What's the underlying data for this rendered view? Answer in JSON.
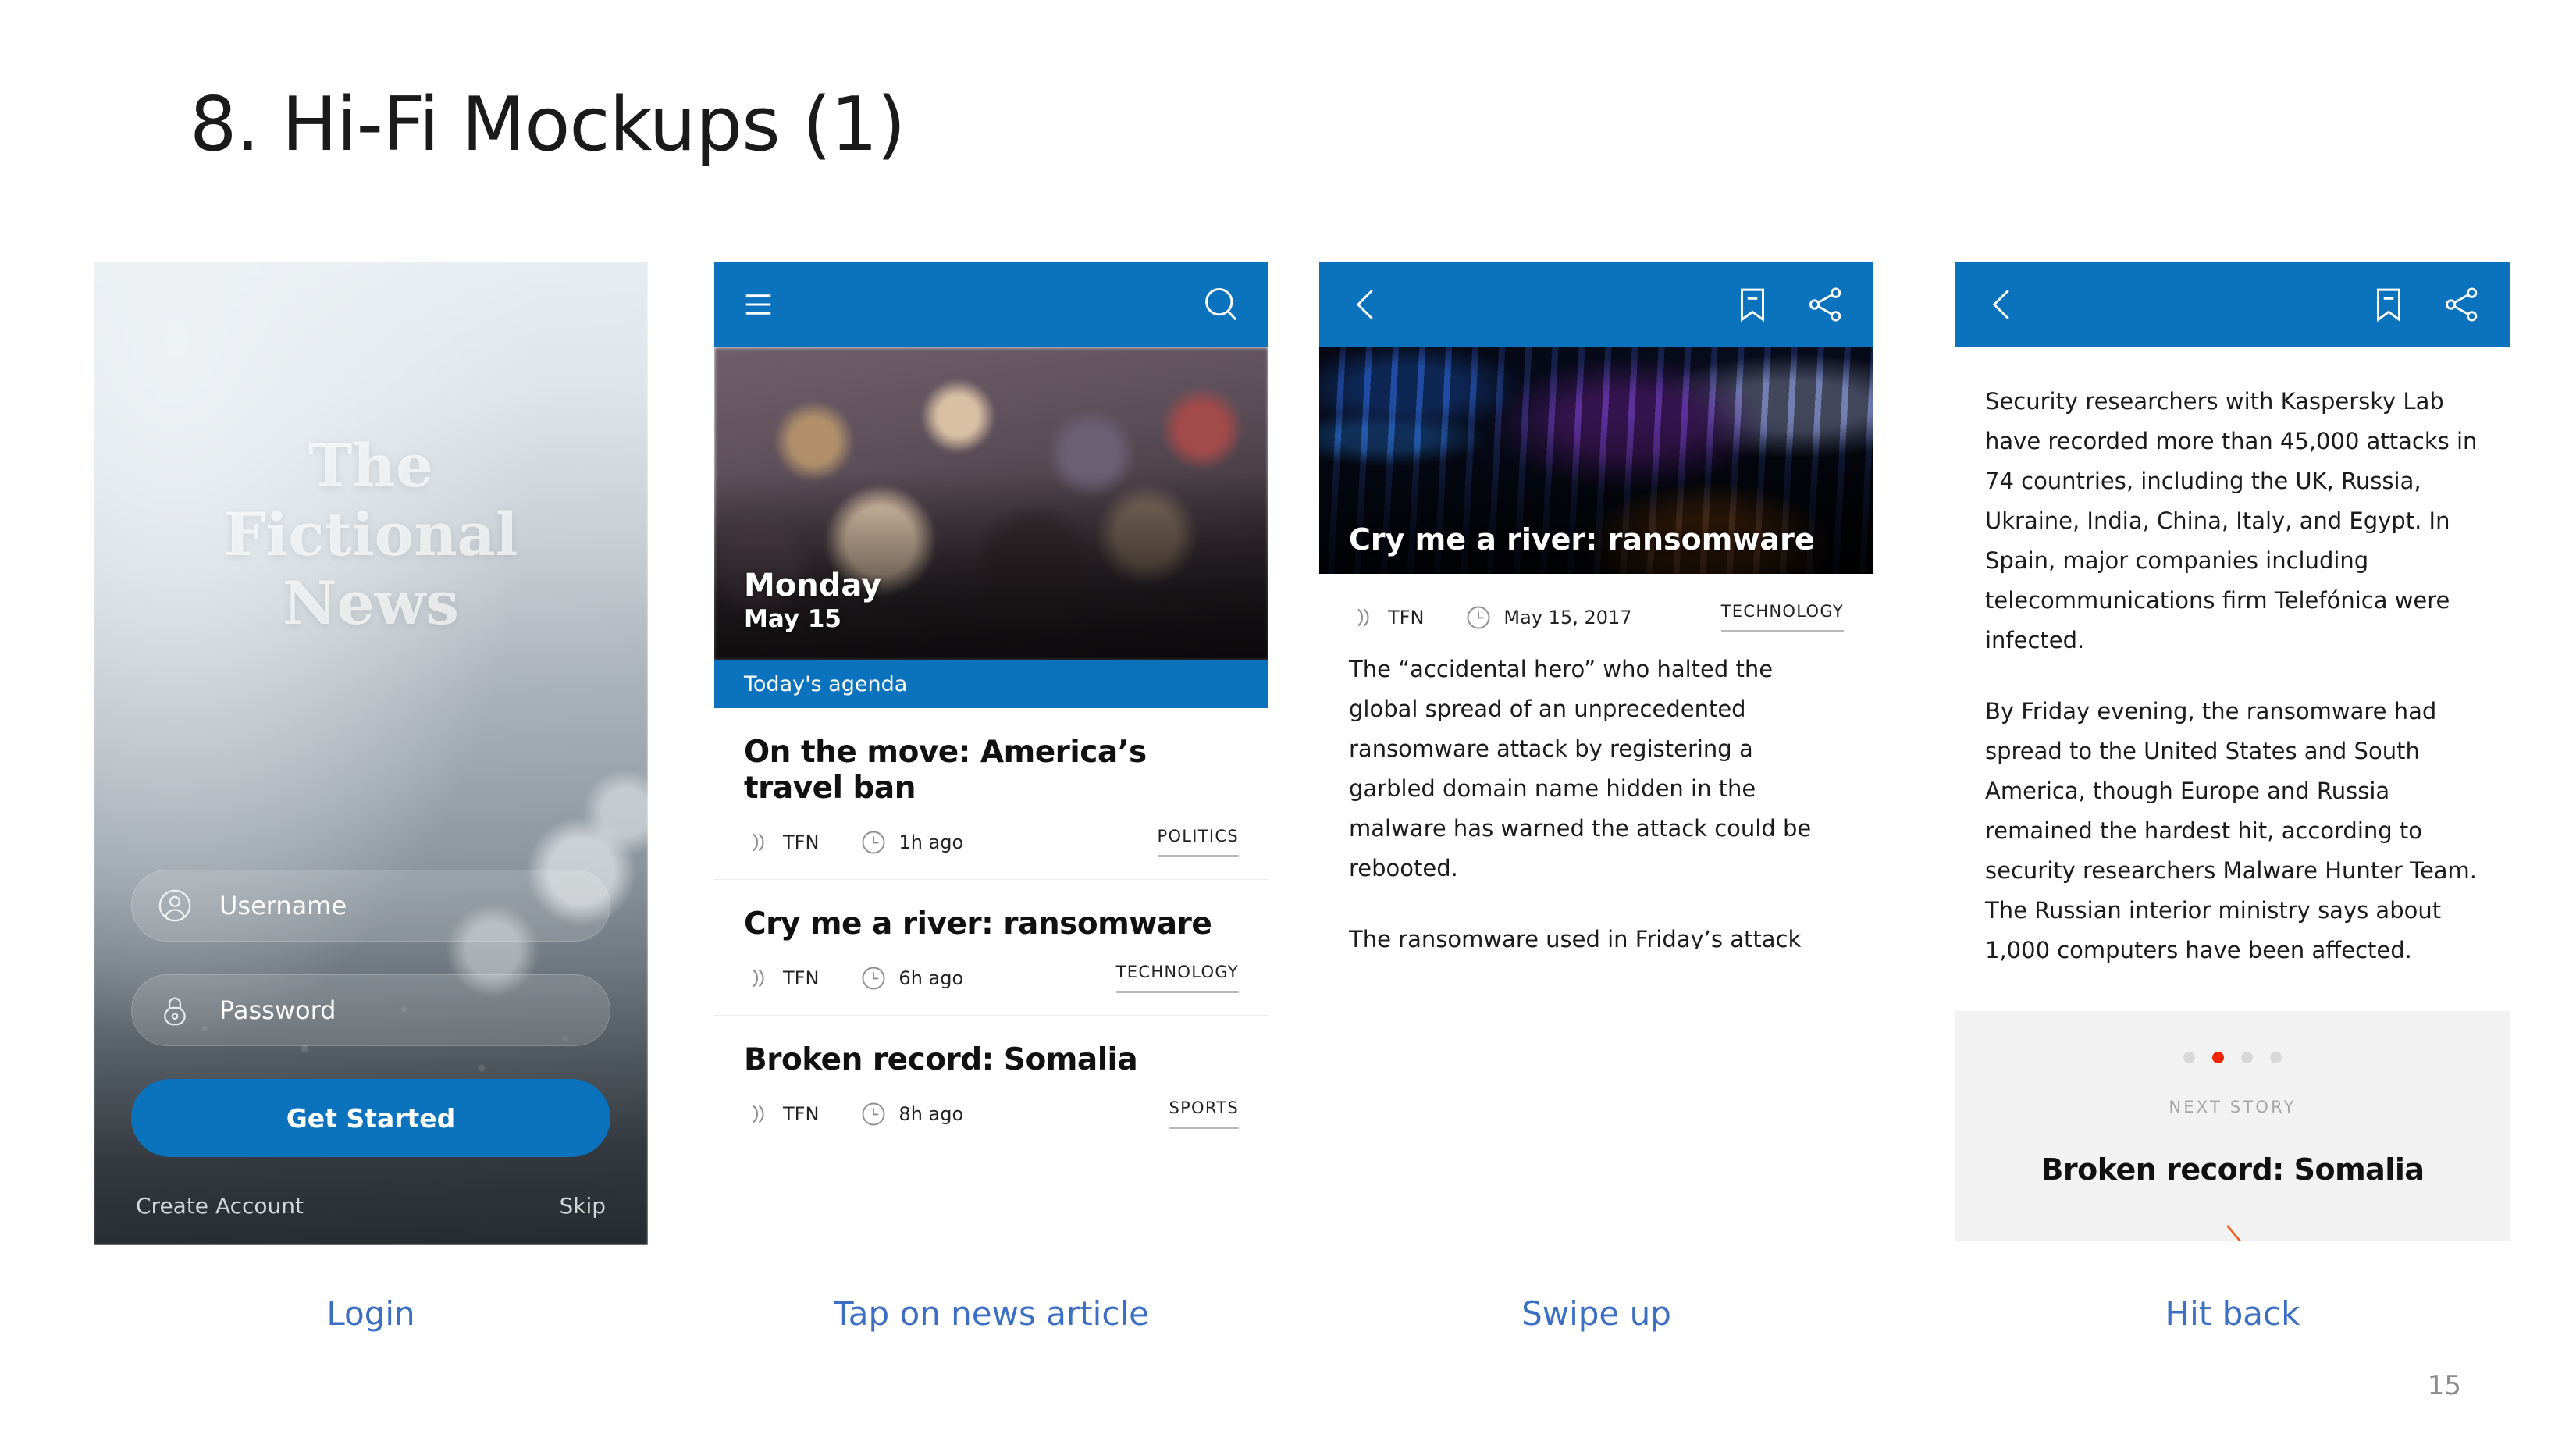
{
  "slide": {
    "title": "8. Hi-Fi Mockups (1)",
    "page_number": "15"
  },
  "captions": {
    "one": "Login",
    "two": "Tap on news article",
    "three": "Swipe up",
    "four": "Hit back"
  },
  "colors": {
    "brand_blue": "#0b72bd",
    "accent_orange": "#f25c1f",
    "dot_active_red": "#f52400",
    "caption_blue": "#3b6fc4"
  },
  "login": {
    "brand_line1": "The",
    "brand_line2": "Fictional",
    "brand_line3": "News",
    "username_placeholder": "Username",
    "password_placeholder": "Password",
    "username_icon": "user-circle-icon",
    "password_icon": "lock-icon",
    "primary_button": "Get Started",
    "create_account": "Create Account",
    "skip": "Skip"
  },
  "feed": {
    "menu_icon": "hamburger-menu-icon",
    "search_icon": "search-icon",
    "hero_day": "Monday",
    "hero_date": "May 15",
    "agenda_label": "Today's agenda",
    "items": [
      {
        "headline": "On the move: America’s travel ban",
        "source": "TFN",
        "source_icon": "broadcast-icon",
        "time_icon": "clock-icon",
        "time": "1h ago",
        "category": "POLITICS"
      },
      {
        "headline": "Cry me a river: ransomware",
        "source": "TFN",
        "source_icon": "broadcast-icon",
        "time_icon": "clock-icon",
        "time": "6h ago",
        "category": "TECHNOLOGY"
      },
      {
        "headline": "Broken record: Somalia",
        "source": "TFN",
        "source_icon": "broadcast-icon",
        "time_icon": "clock-icon",
        "time": "8h ago",
        "category": "SPORTS"
      }
    ]
  },
  "article": {
    "back_icon": "chevron-left-icon",
    "bookmark_icon": "bookmark-minus-icon",
    "share_icon": "share-icon",
    "hero_title": "Cry me a river: ransomware",
    "source": "TFN",
    "source_icon": "broadcast-icon",
    "time_icon": "clock-icon",
    "date": "May 15, 2017",
    "category": "TECHNOLOGY",
    "paragraph1": "The “accidental hero” who halted the global spread of an unprecedented ransomware attack by registering a garbled domain name hidden in the malware has warned the attack could be rebooted.",
    "paragraph2": "The ransomware used in Friday’s attack wreaked havoc on organisations including FedEx and Telefónica, as well as the UK’s National Health Service (NHS), where operations were cancelled, X-rays, test results and patient records became unavailable and phones did not work."
  },
  "scrolled": {
    "back_icon": "chevron-left-icon",
    "bookmark_icon": "bookmark-minus-icon",
    "share_icon": "share-icon",
    "paragraph3": "Security researchers with Kaspersky Lab have recorded more than 45,000 attacks in 74 countries, including the UK, Russia, Ukraine, India, China, Italy, and Egypt. In Spain, major companies including telecommunications firm Telefónica were infected.",
    "paragraph4": "By Friday evening, the ransomware had spread to the United States and South America, though Europe and Russia remained the hardest hit, according to security researchers Malware Hunter Team. The Russian interior ministry says about 1,000 computers have been affected.",
    "next_story": {
      "label": "NEXT STORY",
      "title": "Broken record: Somalia",
      "arrow_icon": "chevron-right-icon",
      "dots_total": 4,
      "dots_active_index": 1
    }
  }
}
